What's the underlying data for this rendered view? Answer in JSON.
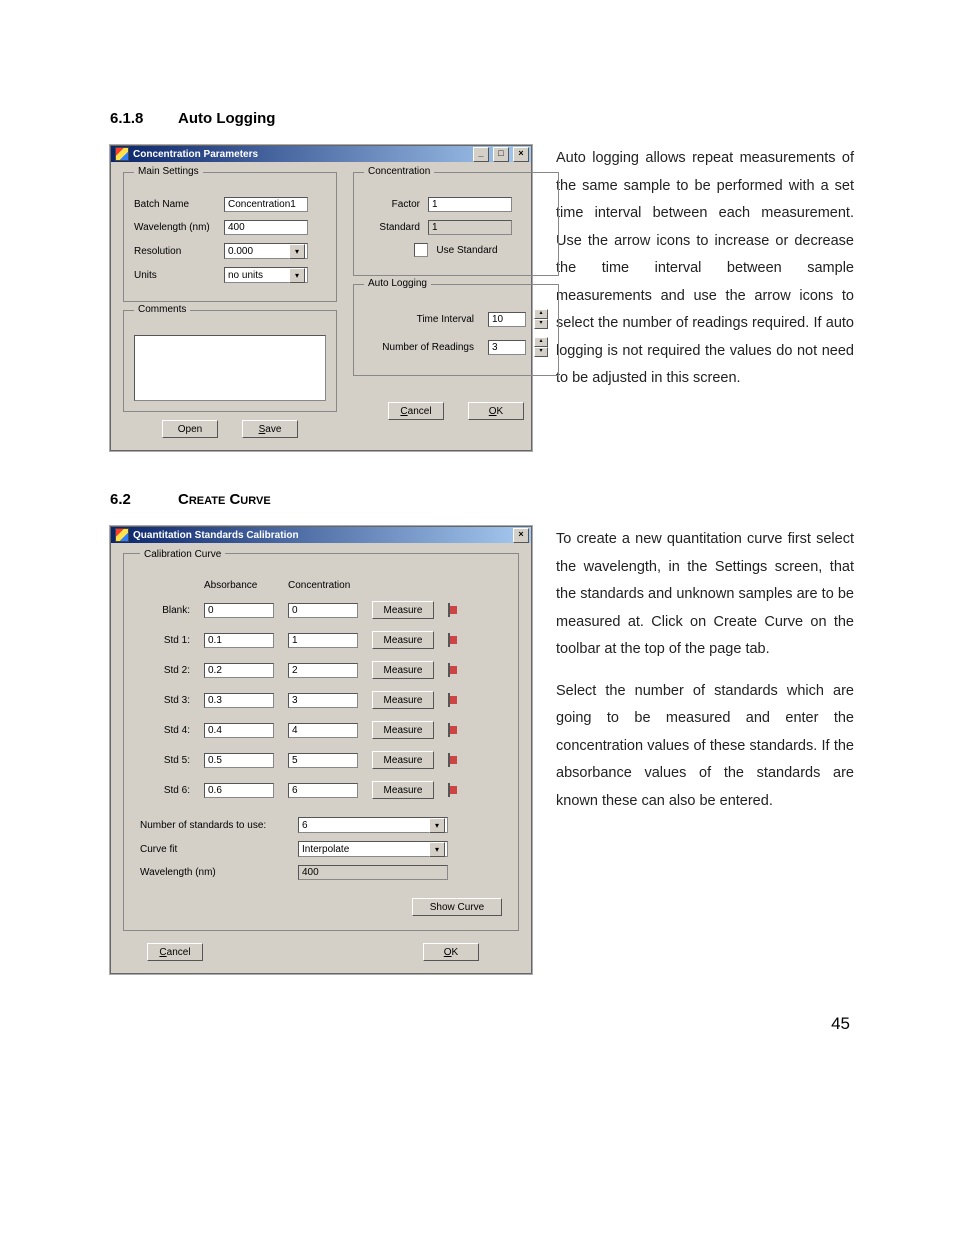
{
  "section1": {
    "number": "6.1.8",
    "title": "Auto Logging",
    "paragraph": "Auto logging allows repeat measurements of the same sample to be performed with a set time interval between each measurement. Use the arrow icons to increase or decrease the time interval between sample measurements and use the arrow icons to select the number of readings required. If auto logging is not required the values do not need to be adjusted in this screen."
  },
  "dialog1": {
    "title": "Concentration Parameters",
    "groups": {
      "main": {
        "legend": "Main Settings",
        "batchName_label": "Batch Name",
        "batchName_value": "Concentration1",
        "wavelength_label": "Wavelength (nm)",
        "wavelength_value": "400",
        "resolution_label": "Resolution",
        "resolution_value": "0.000",
        "units_label": "Units",
        "units_value": "no units"
      },
      "concentration": {
        "legend": "Concentration",
        "factor_label": "Factor",
        "factor_value": "1",
        "standard_label": "Standard",
        "standard_value": "1",
        "useStandard_label": "Use Standard"
      },
      "comments": {
        "legend": "Comments"
      },
      "autoLogging": {
        "legend": "Auto Logging",
        "timeInterval_label": "Time Interval",
        "timeInterval_value": "10",
        "numReadings_label": "Number of Readings",
        "numReadings_value": "3"
      }
    },
    "buttons": {
      "open": "Open",
      "save": "Save",
      "cancel": "Cancel",
      "ok": "OK"
    }
  },
  "section2": {
    "number": "6.2",
    "title": "Create Curve",
    "paragraph1": "To create a new quantitation curve first select the wavelength, in the Settings screen, that the standards and unknown samples are to be measured at. Click on Create Curve on the toolbar at the top of the page tab.",
    "paragraph2": "Select the number of standards which are going to be measured and enter the concentration values of these standards. If the absorbance values of the standards are known these can also be entered."
  },
  "dialog2": {
    "title": "Quantitation Standards Calibration",
    "group": {
      "legend": "Calibration Curve",
      "headers": {
        "abs": "Absorbance",
        "conc": "Concentration"
      },
      "rows": [
        {
          "label": "Blank:",
          "abs": "0",
          "conc": "0"
        },
        {
          "label": "Std 1:",
          "abs": "0.1",
          "conc": "1"
        },
        {
          "label": "Std 2:",
          "abs": "0.2",
          "conc": "2"
        },
        {
          "label": "Std 3:",
          "abs": "0.3",
          "conc": "3"
        },
        {
          "label": "Std 4:",
          "abs": "0.4",
          "conc": "4"
        },
        {
          "label": "Std 5:",
          "abs": "0.5",
          "conc": "5"
        },
        {
          "label": "Std 6:",
          "abs": "0.6",
          "conc": "6"
        }
      ],
      "measure_label": "Measure",
      "numStds_label": "Number of standards to use:",
      "numStds_value": "6",
      "curveFit_label": "Curve fit",
      "curveFit_value": "Interpolate",
      "wavelength_label": "Wavelength (nm)",
      "wavelength_value": "400",
      "showCurve_label": "Show Curve"
    },
    "buttons": {
      "cancel": "Cancel",
      "ok": "OK"
    }
  },
  "pageNumber": "45"
}
